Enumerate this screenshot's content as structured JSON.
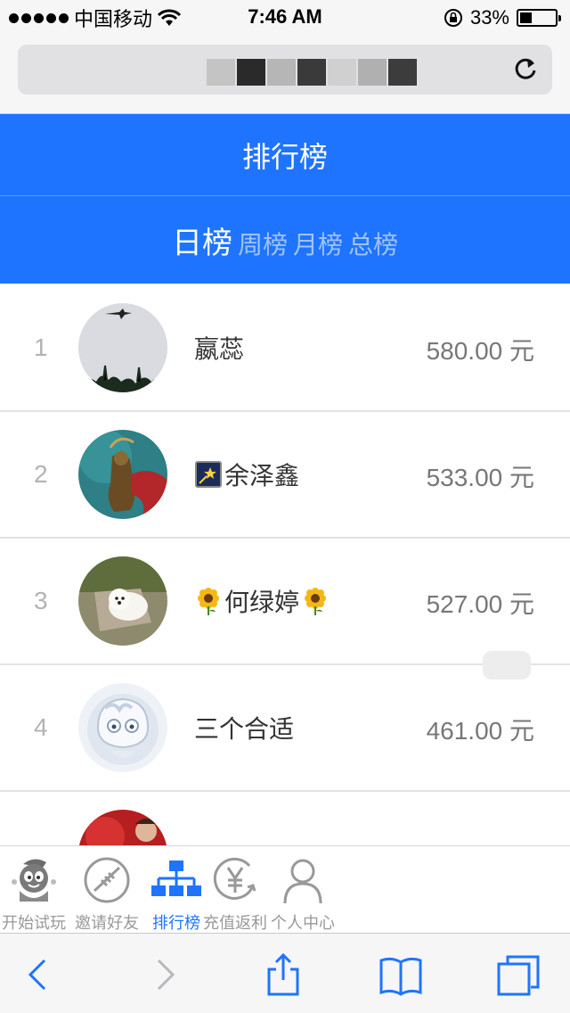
{
  "status_bar": {
    "carrier": "中国移动",
    "time": "7:46 AM",
    "battery": "33%",
    "battery_level": 0.33
  },
  "browser": {
    "reload_icon": "reload-icon"
  },
  "header": {
    "title": "排行榜"
  },
  "tabs": [
    {
      "label": "日榜",
      "active": true
    },
    {
      "label": "周榜",
      "active": false
    },
    {
      "label": "月榜",
      "active": false
    },
    {
      "label": "总榜",
      "active": false
    }
  ],
  "leaderboard": [
    {
      "rank": "1",
      "name": "嬴蕊",
      "amount": "580.00 元"
    },
    {
      "rank": "2",
      "name": "余泽鑫",
      "amount": "533.00 元"
    },
    {
      "rank": "3",
      "name": "何绿婷",
      "amount": "527.00 元"
    },
    {
      "rank": "4",
      "name": "三个合适",
      "amount": "461.00 元"
    }
  ],
  "app_nav": [
    {
      "label": "开始试玩",
      "icon": "mascot-icon"
    },
    {
      "label": "邀请好友",
      "icon": "football-icon"
    },
    {
      "label": "排行榜",
      "icon": "org-chart-icon",
      "active": true
    },
    {
      "label": "充值返利",
      "icon": "yuan-icon"
    },
    {
      "label": "个人中心",
      "icon": "person-icon"
    }
  ],
  "colors": {
    "brand_blue": "#1f74ff",
    "nav_inactive": "#999999"
  }
}
